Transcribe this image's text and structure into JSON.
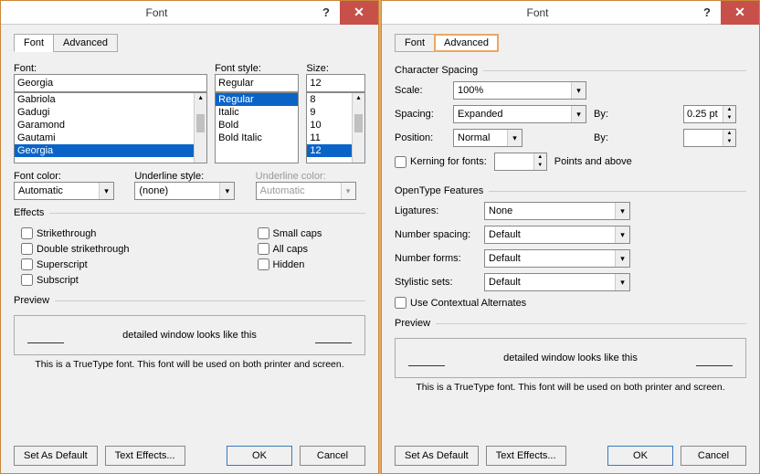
{
  "left": {
    "title": "Font",
    "tabs": {
      "font": "Font",
      "advanced": "Advanced"
    },
    "labels": {
      "font": "Font:",
      "style": "Font style:",
      "size": "Size:",
      "fontColor": "Font color:",
      "underlineStyle": "Underline style:",
      "underlineColor": "Underline color:",
      "effects": "Effects",
      "preview": "Preview"
    },
    "fontInput": "Georgia",
    "fontList": [
      "Gabriola",
      "Gadugi",
      "Garamond",
      "Gautami",
      "Georgia"
    ],
    "styleInput": "Regular",
    "styleList": [
      "Regular",
      "Italic",
      "Bold",
      "Bold Italic"
    ],
    "sizeInput": "12",
    "sizeList": [
      "8",
      "9",
      "10",
      "11",
      "12"
    ],
    "fontColor": "Automatic",
    "underlineStyle": "(none)",
    "underlineColor": "Automatic",
    "effects": {
      "strike": "Strikethrough",
      "dstrike": "Double strikethrough",
      "super": "Superscript",
      "sub": "Subscript",
      "small": "Small caps",
      "all": "All caps",
      "hidden": "Hidden"
    },
    "previewText": "detailed window looks like this",
    "hint": "This is a TrueType font. This font will be used on both printer and screen.",
    "buttons": {
      "setdef": "Set As Default",
      "texteff": "Text Effects...",
      "ok": "OK",
      "cancel": "Cancel"
    }
  },
  "right": {
    "title": "Font",
    "tabs": {
      "font": "Font",
      "advanced": "Advanced"
    },
    "charSpacing": "Character Spacing",
    "labels": {
      "scale": "Scale:",
      "spacing": "Spacing:",
      "position": "Position:",
      "by1": "By:",
      "by2": "By:",
      "kerning": "Kerning for fonts:",
      "pointsAbove": "Points and above"
    },
    "scale": "100%",
    "spacing": "Expanded",
    "spacingBy": "0.25 pt",
    "position": "Normal",
    "positionBy": "",
    "openType": "OpenType Features",
    "otLabels": {
      "ligatures": "Ligatures:",
      "numspacing": "Number spacing:",
      "numforms": "Number forms:",
      "stylistic": "Stylistic sets:",
      "contextual": "Use Contextual Alternates"
    },
    "ligatures": "None",
    "numspacing": "Default",
    "numforms": "Default",
    "stylistic": "Default",
    "preview": "Preview",
    "previewText": "detailed window looks like this",
    "hint": "This is a TrueType font. This font will be used on both printer and screen.",
    "buttons": {
      "setdef": "Set As Default",
      "texteff": "Text Effects...",
      "ok": "OK",
      "cancel": "Cancel"
    }
  }
}
